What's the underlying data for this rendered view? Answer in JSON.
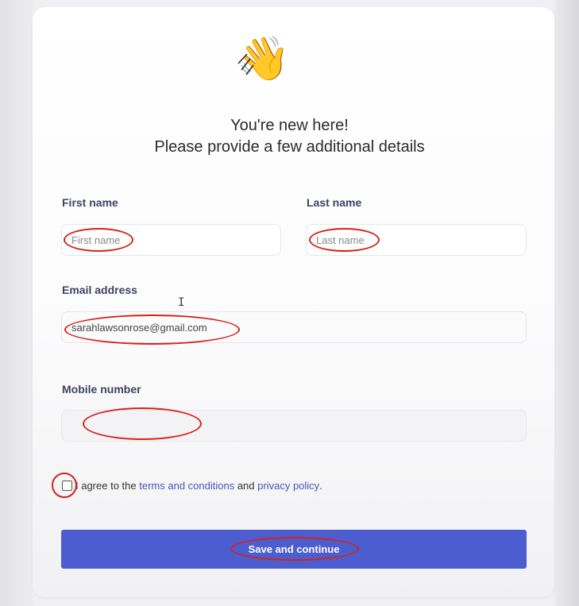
{
  "header": {
    "title_line1": "You're new here!",
    "title_line2": "Please provide a few additional details"
  },
  "icons": {
    "wave": "waving-hand-icon",
    "cursor": "text-cursor-icon"
  },
  "form": {
    "first_name": {
      "label": "First name",
      "placeholder": "First name",
      "value": ""
    },
    "last_name": {
      "label": "Last name",
      "placeholder": "Last name",
      "value": ""
    },
    "email": {
      "label": "Email address",
      "placeholder": "",
      "value": "sarahlawsonrose@gmail.com"
    },
    "mobile": {
      "label": "Mobile number",
      "placeholder": "",
      "value": ""
    },
    "agreement": {
      "prefix": "I agree to the",
      "terms_link": "terms and conditions",
      "middle": "and",
      "privacy_link": "privacy policy",
      "suffix": ".",
      "checked": false
    },
    "submit_label": "Save and continue"
  },
  "colors": {
    "accent": "#4c5dcf",
    "link": "#4656b8",
    "label": "#3f4463",
    "annotation": "#d4231c"
  }
}
